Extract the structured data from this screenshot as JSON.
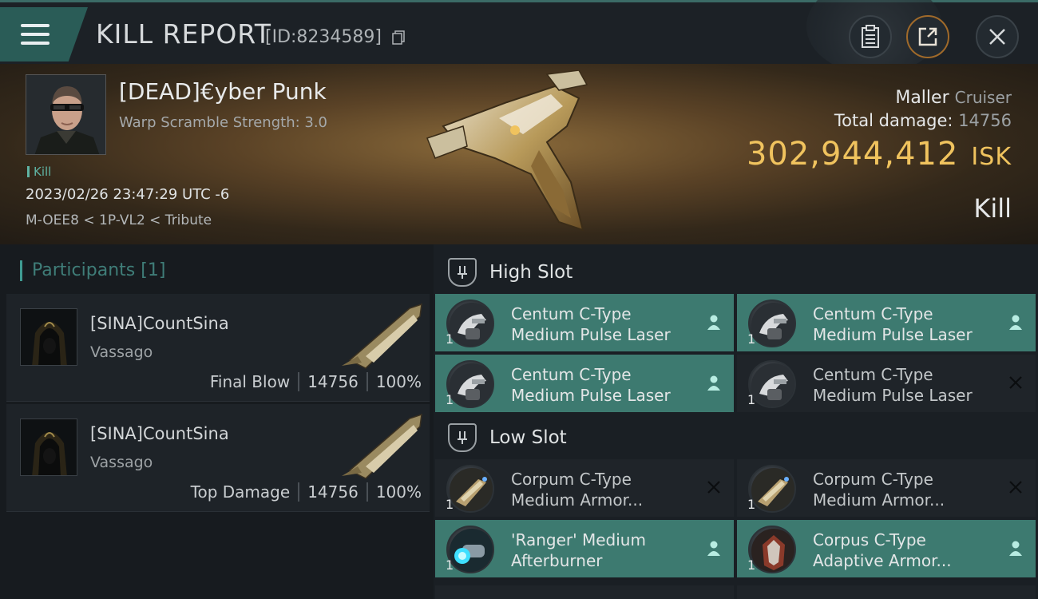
{
  "header": {
    "title": "KILL REPORT",
    "report_id": "[ID:8234589]"
  },
  "victim": {
    "name": "[DEAD]€yber Punk",
    "subtitle": "Warp Scramble Strength: 3.0",
    "tag": "Kill",
    "timestamp": "2023/02/26 23:47:29 UTC -6",
    "location": "M-OEE8 < 1P-VL2 < Tribute",
    "ship": "Maller",
    "ship_class": "Cruiser",
    "total_damage_label": "Total damage:",
    "total_damage": "14756",
    "isk_value": "302,944,412",
    "isk_unit": "ISK",
    "result": "Kill"
  },
  "participants": {
    "header": "Participants",
    "count": "[1]",
    "items": [
      {
        "name": "[SINA]CountSina",
        "ship": "Vassago",
        "role": "Final Blow",
        "damage": "14756",
        "percent": "100%"
      },
      {
        "name": "[SINA]CountSina",
        "ship": "Vassago",
        "role": "Top Damage",
        "damage": "14756",
        "percent": "100%"
      }
    ]
  },
  "slots": {
    "high": {
      "label": "High Slot",
      "modules": [
        {
          "line1": "Centum C-Type",
          "line2": "Medium Pulse Laser",
          "qty": "1",
          "status": "dropped"
        },
        {
          "line1": "Centum C-Type",
          "line2": "Medium Pulse Laser",
          "qty": "1",
          "status": "dropped"
        },
        {
          "line1": "Centum C-Type",
          "line2": "Medium Pulse Laser",
          "qty": "1",
          "status": "dropped"
        },
        {
          "line1": "Centum C-Type",
          "line2": "Medium Pulse Laser",
          "qty": "1",
          "status": "destroyed"
        }
      ]
    },
    "low": {
      "label": "Low Slot",
      "modules": [
        {
          "line1": "Corpum C-Type",
          "line2": "Medium Armor...",
          "qty": "1",
          "status": "destroyed"
        },
        {
          "line1": "Corpum C-Type",
          "line2": "Medium Armor...",
          "qty": "1",
          "status": "destroyed"
        },
        {
          "line1": "'Ranger' Medium",
          "line2": "Afterburner",
          "qty": "1",
          "status": "dropped"
        },
        {
          "line1": "Corpus C-Type",
          "line2": "Adaptive Armor...",
          "qty": "1",
          "status": "dropped"
        }
      ]
    }
  },
  "colors": {
    "accent": "#3d7a70",
    "isk": "#f0c35e",
    "teal_text": "#3f7d78"
  }
}
